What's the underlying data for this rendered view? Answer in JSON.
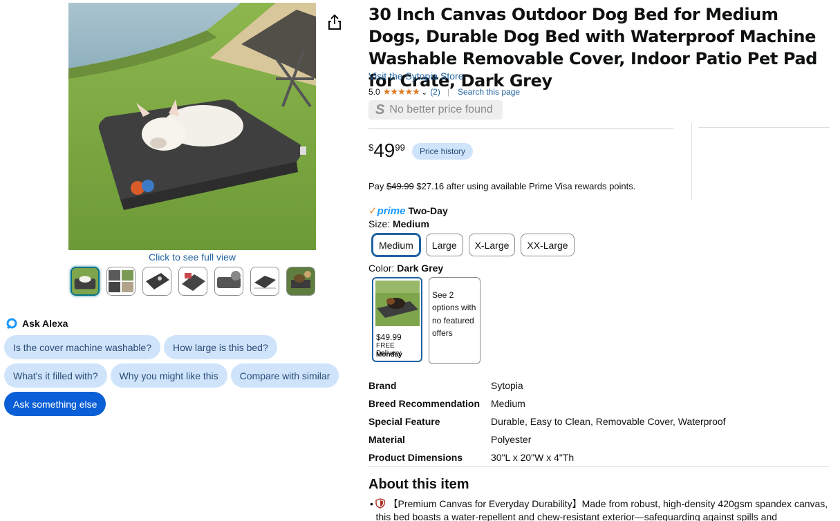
{
  "product": {
    "title": "30 Inch Canvas Outdoor Dog Bed for Medium Dogs, Durable Dog Bed with Waterproof Machine Washable Removable Cover, Indoor Patio Pet Pad for Crate, Dark Grey",
    "store_link": "Visit the Sytopia Store",
    "rating_score": "5.0",
    "stars": "★★★★★",
    "rating_count": "(2)",
    "search_page": "Search this page",
    "price_badge": "No better price found",
    "price_symbol": "$",
    "price_whole": "49",
    "price_fraction": "99",
    "price_history_label": "Price history",
    "pay_prefix": "Pay ",
    "pay_original": "$49.99",
    "pay_suffix": " $27.16 after using available Prime Visa rewards points.",
    "prime_check": "✓",
    "prime_word": "prime",
    "prime_delivery": "Two-Day"
  },
  "gallery": {
    "full_view_link": "Click to see full view"
  },
  "alexa": {
    "heading": "Ask Alexa",
    "rows": [
      [
        "Is the cover machine washable?",
        "How large is this bed?"
      ],
      [
        "What's it filled with?",
        "Why you might like this",
        "Compare with similar"
      ],
      [
        "Ask something else"
      ]
    ]
  },
  "size": {
    "label": "Size: ",
    "selected": "Medium",
    "options": [
      "Medium",
      "Large",
      "X-Large",
      "XX-Large"
    ]
  },
  "color": {
    "label": "Color: ",
    "selected": "Dark Grey",
    "swatch_price": "$49.99",
    "swatch_delivery": "FREE Delivery",
    "swatch_day": "Monday",
    "other_options": "See 2 options with no featured offers"
  },
  "specs": [
    {
      "key": "Brand",
      "value": "Sytopia"
    },
    {
      "key": "Breed Recommendation",
      "value": "Medium"
    },
    {
      "key": "Special Feature",
      "value": "Durable, Easy to Clean, Removable Cover, Waterproof"
    },
    {
      "key": "Material",
      "value": "Polyester"
    },
    {
      "key": "Product Dimensions",
      "value": "30\"L x 20\"W x 4\"Th"
    }
  ],
  "about": {
    "title": "About this item",
    "bullet_1": "【Premium Canvas for Everyday Durability】Made from robust, high-density 420gsm spandex canvas, this bed boasts a water-repellent and chew-resistant exterior—safeguarding against spills and"
  },
  "colors": {
    "link": "#2162a1",
    "chip_bg": "#cfe4fb",
    "chip_primary": "#0b5fd6",
    "star": "#de7921",
    "prime": "#1a98ff"
  }
}
